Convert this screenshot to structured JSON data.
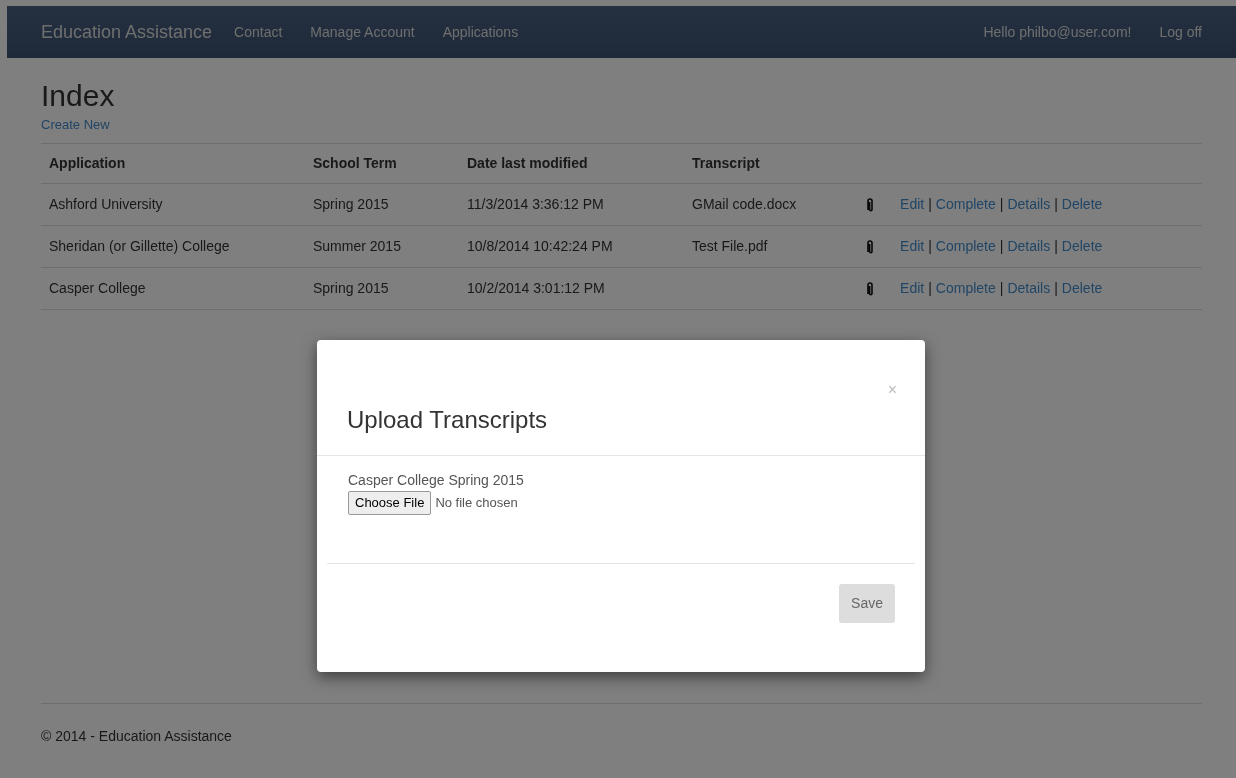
{
  "navbar": {
    "brand": "Education Assistance",
    "links": [
      {
        "label": "Contact"
      },
      {
        "label": "Manage Account"
      },
      {
        "label": "Applications"
      }
    ],
    "greeting": "Hello philbo@user.com!",
    "logoff": "Log off"
  },
  "page": {
    "title": "Index",
    "create_link": "Create New"
  },
  "table": {
    "columns": [
      "Application",
      "School Term",
      "Date last modified",
      "Transcript"
    ],
    "rows": [
      {
        "application": "Ashford University",
        "term": "Spring 2015",
        "modified": "11/3/2014 3:36:12 PM",
        "transcript": "GMail code.docx",
        "actions": [
          {
            "kind": "link",
            "text": "Edit"
          },
          {
            "kind": "separator",
            "text": "|"
          },
          {
            "kind": "link",
            "text": "Complete"
          },
          {
            "kind": "separator",
            "text": "|"
          },
          {
            "kind": "link",
            "text": "Details"
          },
          {
            "kind": "separator",
            "text": "|"
          },
          {
            "kind": "link",
            "text": "Delete"
          }
        ]
      },
      {
        "application": "Sheridan (or Gillette) College",
        "term": "Summer 2015",
        "modified": "10/8/2014 10:42:24 PM",
        "transcript": "Test File.pdf",
        "actions": [
          {
            "kind": "link",
            "text": "Edit"
          },
          {
            "kind": "separator",
            "text": "|"
          },
          {
            "kind": "link",
            "text": "Complete"
          },
          {
            "kind": "separator",
            "text": "|"
          },
          {
            "kind": "link",
            "text": "Details"
          },
          {
            "kind": "separator",
            "text": "|"
          },
          {
            "kind": "link",
            "text": "Delete"
          }
        ]
      },
      {
        "application": "Casper College",
        "term": "Spring 2015",
        "modified": "10/2/2014 3:01:12 PM",
        "actions": [
          {
            "kind": "link",
            "text": "Edit"
          },
          {
            "kind": "separator",
            "text": "|"
          },
          {
            "kind": "link",
            "text": "Complete"
          },
          {
            "kind": "separator",
            "text": "|"
          },
          {
            "kind": "link",
            "text": "Details"
          },
          {
            "kind": "separator",
            "text": "|"
          },
          {
            "kind": "link",
            "text": "Delete"
          }
        ]
      }
    ]
  },
  "footer": "© 2014 - Education Assistance",
  "modal": {
    "title": "Upload Transcripts",
    "close": "×",
    "label": "Casper College Spring 2015",
    "choose_button": "Choose File",
    "file_status": "No file chosen",
    "save_button": "Save"
  }
}
